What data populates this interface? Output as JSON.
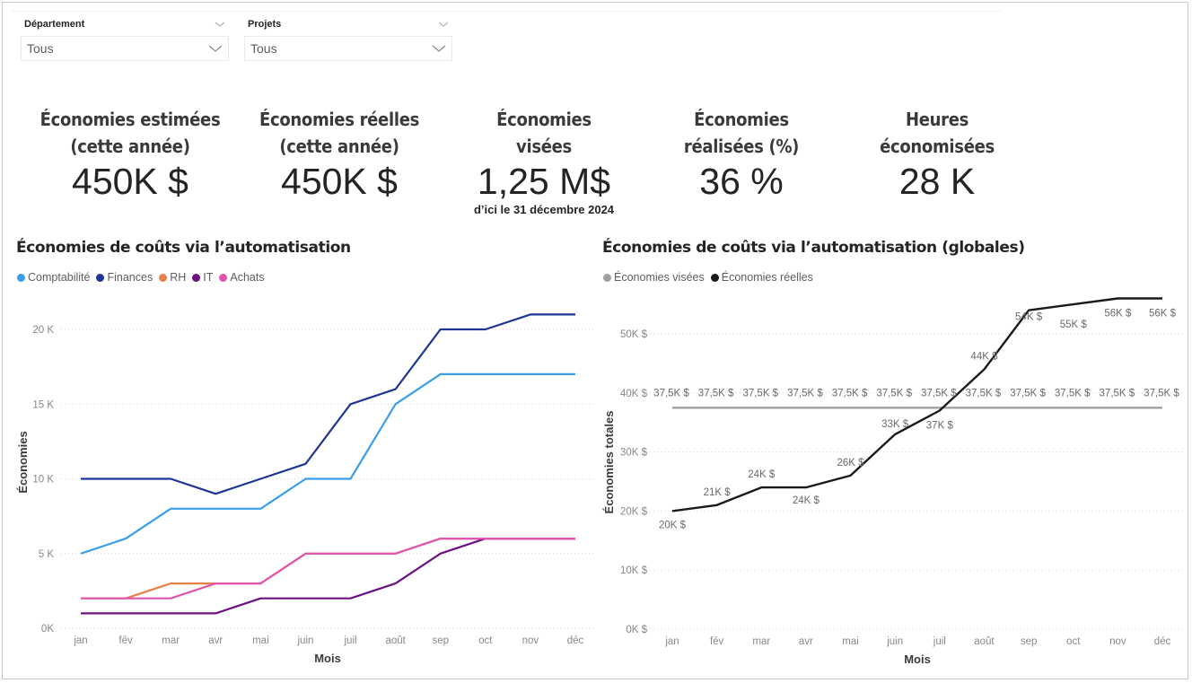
{
  "filters": [
    {
      "label": "Département",
      "value": "Tous"
    },
    {
      "label": "Projets",
      "value": "Tous"
    }
  ],
  "kpis": [
    {
      "title_line1": "Économies estimées",
      "title_line2": "(cette année)",
      "value": "450K $",
      "subtitle": ""
    },
    {
      "title_line1": "Économies réelles",
      "title_line2": "(cette année)",
      "value": "450K $",
      "subtitle": ""
    },
    {
      "title_line1": "Économies",
      "title_line2": "visées",
      "value": "1,25 M$",
      "subtitle": "d’ici le 31 décembre 2024"
    },
    {
      "title_line1": "Économies",
      "title_line2": "réalisées (%)",
      "value": "36 %",
      "subtitle": ""
    },
    {
      "title_line1": "Heures",
      "title_line2": "économisées",
      "value": "28 K",
      "subtitle": ""
    }
  ],
  "chart_data": [
    {
      "type": "line",
      "title": "Économies de coûts via l’automatisation",
      "xlabel": "Mois",
      "ylabel": "Économies",
      "categories": [
        "jan",
        "fév",
        "mar",
        "avr",
        "mai",
        "juin",
        "juil",
        "août",
        "sep",
        "oct",
        "nov",
        "déc"
      ],
      "ylim": [
        0,
        20000
      ],
      "yticks": [
        0,
        5000,
        10000,
        15000,
        20000
      ],
      "ytick_labels": [
        "0K",
        "5 K",
        "10 K",
        "15 K",
        "20 K"
      ],
      "grid": true,
      "legend_position": "top-left",
      "series": [
        {
          "name": "Comptabilité",
          "color": "#3a9ee8",
          "values": [
            5000,
            6000,
            8000,
            8000,
            8000,
            10000,
            10000,
            15000,
            17000,
            17000,
            17000,
            17000
          ]
        },
        {
          "name": "Finances",
          "color": "#1f3594",
          "values": [
            10000,
            10000,
            10000,
            9000,
            10000,
            11000,
            15000,
            16000,
            20000,
            20000,
            21000,
            21000
          ]
        },
        {
          "name": "RH",
          "color": "#e8804a",
          "values": [
            2000,
            2000,
            3000,
            3000,
            3000,
            5000,
            5000,
            5000,
            6000,
            6000,
            6000,
            6000
          ]
        },
        {
          "name": "IT",
          "color": "#6b1282",
          "values": [
            1000,
            1000,
            1000,
            1000,
            2000,
            2000,
            2000,
            3000,
            5000,
            6000,
            6000,
            6000
          ]
        },
        {
          "name": "Achats",
          "color": "#e055b0",
          "values": [
            2000,
            2000,
            2000,
            3000,
            3000,
            5000,
            5000,
            5000,
            6000,
            6000,
            6000,
            6000
          ]
        }
      ]
    },
    {
      "type": "line",
      "title": "Économies de coûts via l’automatisation (globales)",
      "xlabel": "Mois",
      "ylabel": "Économies totales",
      "categories": [
        "jan",
        "fév",
        "mar",
        "avr",
        "mai",
        "juin",
        "juil",
        "août",
        "sep",
        "oct",
        "nov",
        "déc"
      ],
      "ylim": [
        0,
        56000
      ],
      "yticks": [
        0,
        10000,
        20000,
        30000,
        40000,
        50000
      ],
      "ytick_labels": [
        "0K $",
        "10K $",
        "20K $",
        "30K $",
        "40K $",
        "50K $"
      ],
      "grid": true,
      "legend_position": "top-left",
      "series": [
        {
          "name": "Économies visées",
          "color": "#a0a0a0",
          "values": [
            37500,
            37500,
            37500,
            37500,
            37500,
            37500,
            37500,
            37500,
            37500,
            37500,
            37500,
            37500
          ],
          "labels": [
            "37,5K $",
            "37,5K $",
            "37,5K $",
            "37,5K $",
            "37,5K $",
            "37,5K $",
            "37,5K $",
            "37,5K $",
            "37,5K $",
            "37,5K $",
            "37,5K $",
            "37,5K $"
          ]
        },
        {
          "name": "Économies réelles",
          "color": "#1a1a1a",
          "values": [
            20000,
            21000,
            24000,
            24000,
            26000,
            33000,
            37000,
            44000,
            54000,
            55000,
            56000,
            56000
          ],
          "labels": [
            "20K $",
            "21K $",
            "24K $",
            "24K $",
            "26K $",
            "33K $",
            "37K $",
            "44K $",
            "54K $",
            "55K $",
            "56K $",
            "56K $"
          ]
        }
      ]
    }
  ]
}
